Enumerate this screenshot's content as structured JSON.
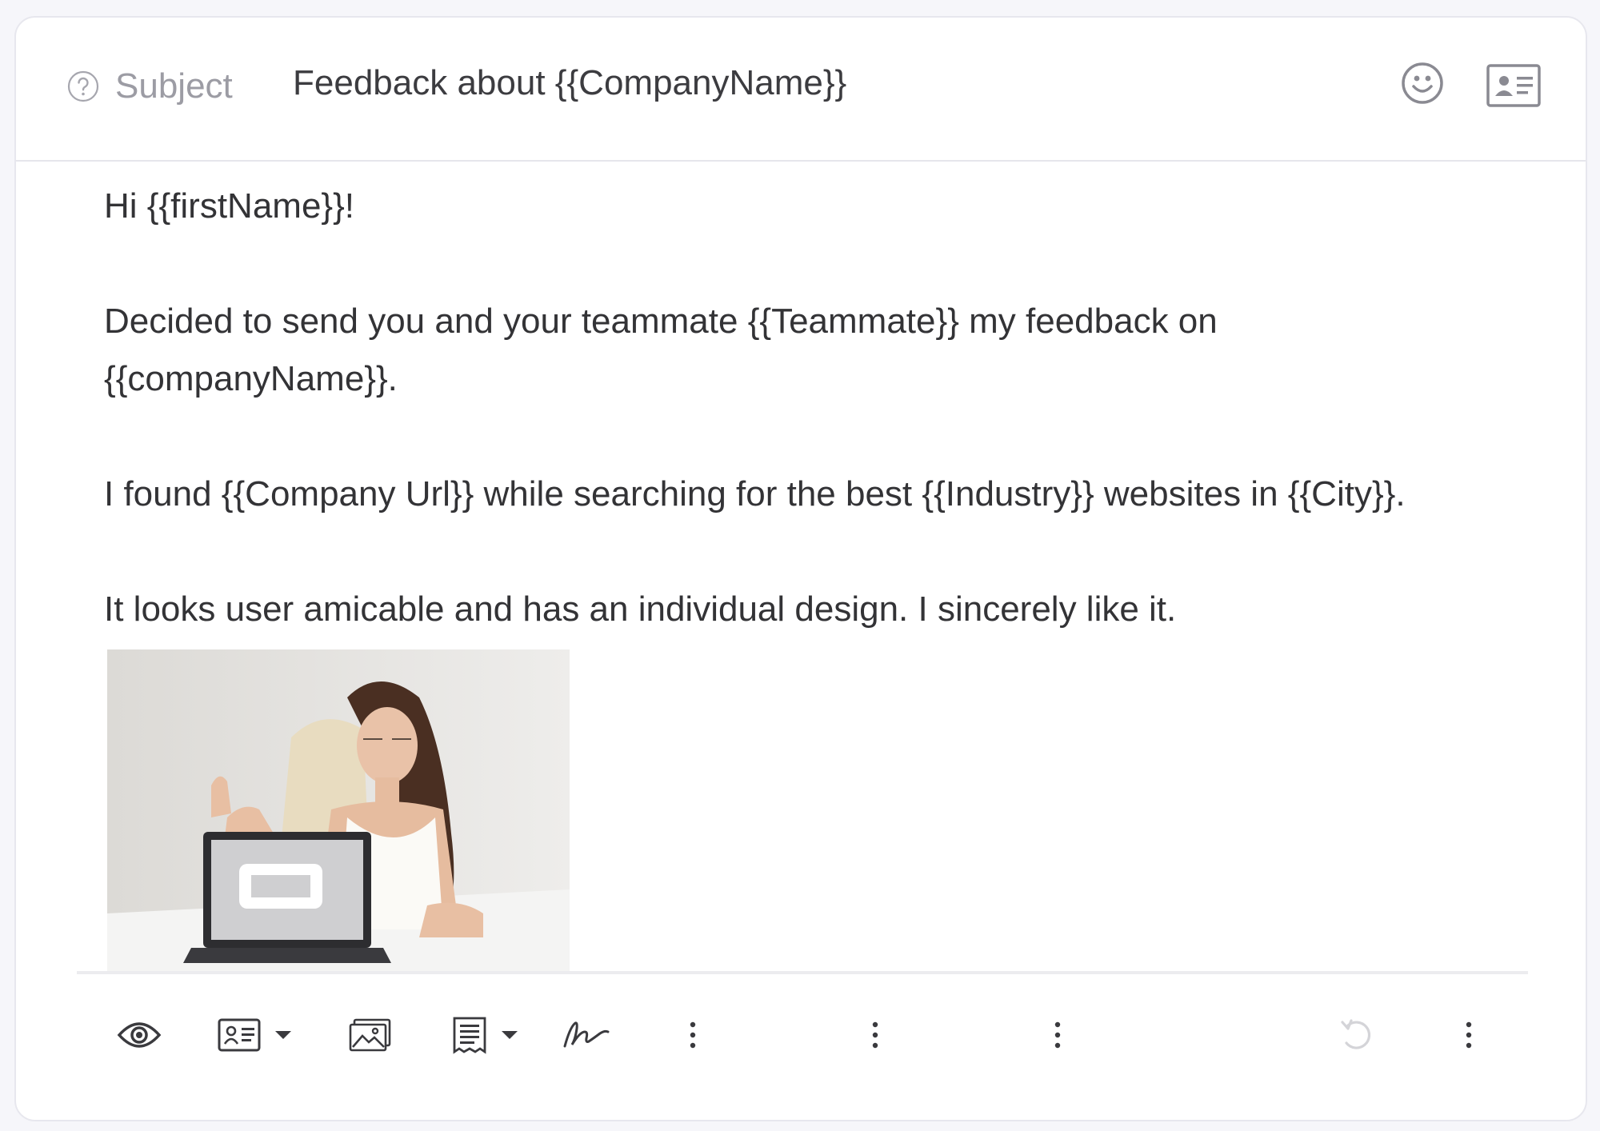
{
  "subject": {
    "label": "Subject",
    "value": "Feedback about {{CompanyName}}",
    "help_icon": "question-circle-icon",
    "emoji_icon": "smiley-icon",
    "contact_icon": "contact-card-icon"
  },
  "body": {
    "greeting": "Hi {{firstName}}!",
    "paragraph1": "Decided to send you and your teammate {{Teammate}} my feedback on {{companyName}}.",
    "paragraph2": "I found {{Company Url}} while searching for the best {{Industry}} websites in {{City}}.",
    "paragraph3": "It looks user amicable and has an individual design. I sincerely like it."
  },
  "toolbar": {
    "items": [
      "eye-icon",
      "contact-card-icon",
      "dropdown-caret-icon",
      "image-icon",
      "template-icon",
      "dropdown-caret-icon",
      "signature-icon",
      "more-vertical-icon",
      "more-vertical-icon",
      "more-vertical-icon",
      "undo-icon",
      "more-vertical-icon"
    ]
  },
  "colors": {
    "card_border": "#e7e7ee",
    "text_primary": "#333336",
    "text_muted": "#9c9ca4",
    "icon_gray": "#4a4a50"
  }
}
